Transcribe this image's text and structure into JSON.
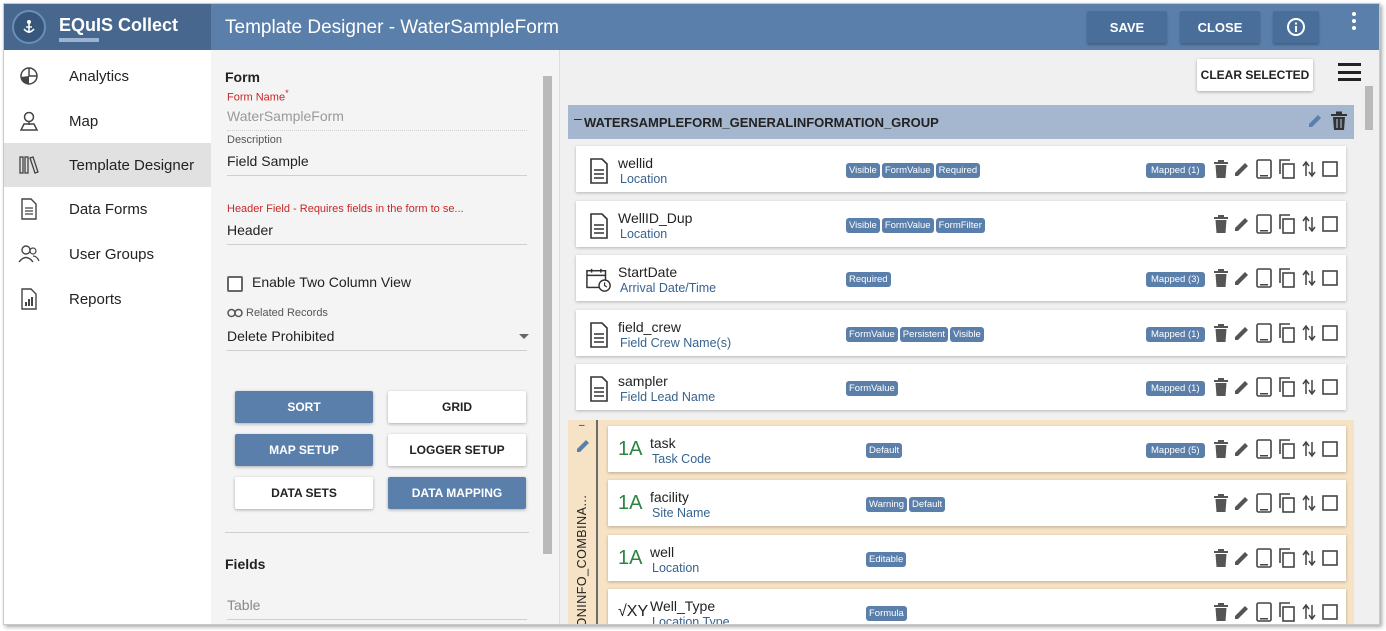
{
  "header": {
    "brand": "EQuIS Collect",
    "title": "Template Designer - WaterSampleForm",
    "save_label": "SAVE",
    "close_label": "CLOSE"
  },
  "sidebar": {
    "items": [
      {
        "label": "Analytics",
        "icon": "pie-chart-icon"
      },
      {
        "label": "Map",
        "icon": "map-pin-icon"
      },
      {
        "label": "Template Designer",
        "icon": "library-icon",
        "active": true
      },
      {
        "label": "Data Forms",
        "icon": "document-icon"
      },
      {
        "label": "User Groups",
        "icon": "users-icon"
      },
      {
        "label": "Reports",
        "icon": "report-icon"
      }
    ]
  },
  "form": {
    "section_title": "Form",
    "form_name_label": "Form Name",
    "form_name_required": "*",
    "form_name_value": "WaterSampleForm",
    "description_label": "Description",
    "description_value": "Field Sample",
    "header_field_label": "Header Field - Requires fields in the form to se...",
    "header_field_value": "Header",
    "two_column_label": "Enable Two Column View",
    "related_records_label": "Related Records",
    "related_records_value": "Delete Prohibited",
    "buttons": {
      "sort": "SORT",
      "grid": "GRID",
      "map_setup": "MAP SETUP",
      "logger_setup": "LOGGER SETUP",
      "data_sets": "DATA SETS",
      "data_mapping": "DATA MAPPING"
    },
    "fields_title": "Fields",
    "table_placeholder": "Table"
  },
  "designer": {
    "clear_selected_label": "CLEAR SELECTED",
    "group_title": "WATERSAMPLEFORM_GENERALINFORMATION_GROUP",
    "group_collapse": "–",
    "sub_group_title": "CATIONINFO_COMBINA...",
    "fields": [
      {
        "name": "wellid",
        "sub": "Location",
        "tags": [
          "Visible",
          "FormValue",
          "Required"
        ],
        "mapped": "Mapped  (1)",
        "icon": "document-icon"
      },
      {
        "name": "WellID_Dup",
        "sub": "Location",
        "tags": [
          "Visible",
          "FormValue",
          "FormFilter"
        ],
        "mapped": "",
        "icon": "document-icon"
      },
      {
        "name": "StartDate",
        "sub": "Arrival Date/Time",
        "tags": [
          "Required"
        ],
        "mapped": "Mapped  (3)",
        "icon": "calendar-clock-icon"
      },
      {
        "name": "field_crew",
        "sub": "Field Crew Name(s)",
        "tags": [
          "FormValue",
          "Persistent",
          "Visible"
        ],
        "mapped": "Mapped  (1)",
        "icon": "document-icon"
      },
      {
        "name": "sampler",
        "sub": "Field Lead Name",
        "tags": [
          "FormValue"
        ],
        "mapped": "Mapped  (1)",
        "icon": "document-icon"
      }
    ],
    "sub_fields": [
      {
        "name": "task",
        "sub": "Task Code",
        "tags": [
          "Default"
        ],
        "mapped": "Mapped  (5)",
        "icon_text": "1A"
      },
      {
        "name": "facility",
        "sub": "Site Name",
        "tags": [
          "Warning",
          "Default"
        ],
        "mapped": "",
        "icon_text": "1A"
      },
      {
        "name": "well",
        "sub": "Location",
        "tags": [
          "Editable"
        ],
        "mapped": "",
        "icon_text": "1A"
      },
      {
        "name": "Well_Type",
        "sub": "Location Type",
        "tags": [
          "Formula"
        ],
        "mapped": "",
        "icon_text": "√XY"
      }
    ]
  }
}
